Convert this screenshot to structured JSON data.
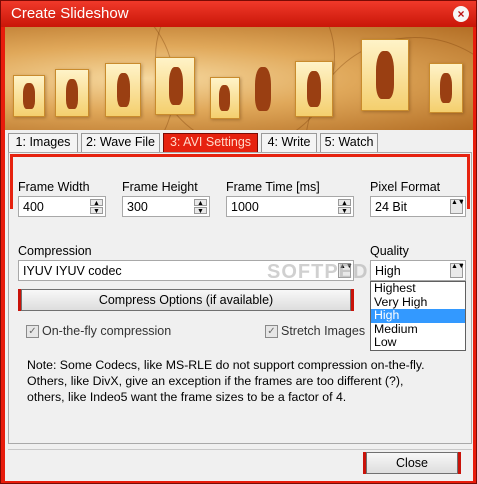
{
  "window": {
    "title": "Create Slideshow",
    "close_glyph": "×",
    "accent_color": "#e6220f"
  },
  "tabs": [
    {
      "label": "1: Images"
    },
    {
      "label": "2: Wave File"
    },
    {
      "label": "3: AVI Settings",
      "active": true
    },
    {
      "label": "4: Write"
    },
    {
      "label": "5: Watch"
    }
  ],
  "fields": {
    "frame_width": {
      "label": "Frame Width",
      "value": "400"
    },
    "frame_height": {
      "label": "Frame Height",
      "value": "300"
    },
    "frame_time": {
      "label": "Frame Time [ms]",
      "value": "1000"
    },
    "pixel_format": {
      "label": "Pixel Format",
      "value": "24 Bit"
    },
    "compression": {
      "label": "Compression",
      "value": "IYUV IYUV codec"
    },
    "quality": {
      "label": "Quality",
      "value": "High"
    }
  },
  "quality_options": [
    {
      "label": "Highest"
    },
    {
      "label": "Very High"
    },
    {
      "label": "High",
      "selected": true
    },
    {
      "label": "Medium"
    },
    {
      "label": "Low"
    }
  ],
  "buttons": {
    "compress_options": "Compress Options (if available)",
    "close": "Close"
  },
  "checkboxes": {
    "on_the_fly": {
      "label": "On-the-fly compression",
      "checked": true
    },
    "stretch_images": {
      "label": "Stretch Images",
      "checked": true
    }
  },
  "note": {
    "line1": "Note: Some Codecs, like MS-RLE do not support compression on-the-fly.",
    "line2": "Others, like DivX, give an exception if the frames are too different (?),",
    "line3": "others, like Indeo5 want the frame sizes to be a factor of 4."
  },
  "watermark": "SOFTPEDIA",
  "icons": {
    "spin_up": "▲",
    "spin_down": "▼",
    "combo_arrow": "▲▼",
    "check": "✓"
  }
}
